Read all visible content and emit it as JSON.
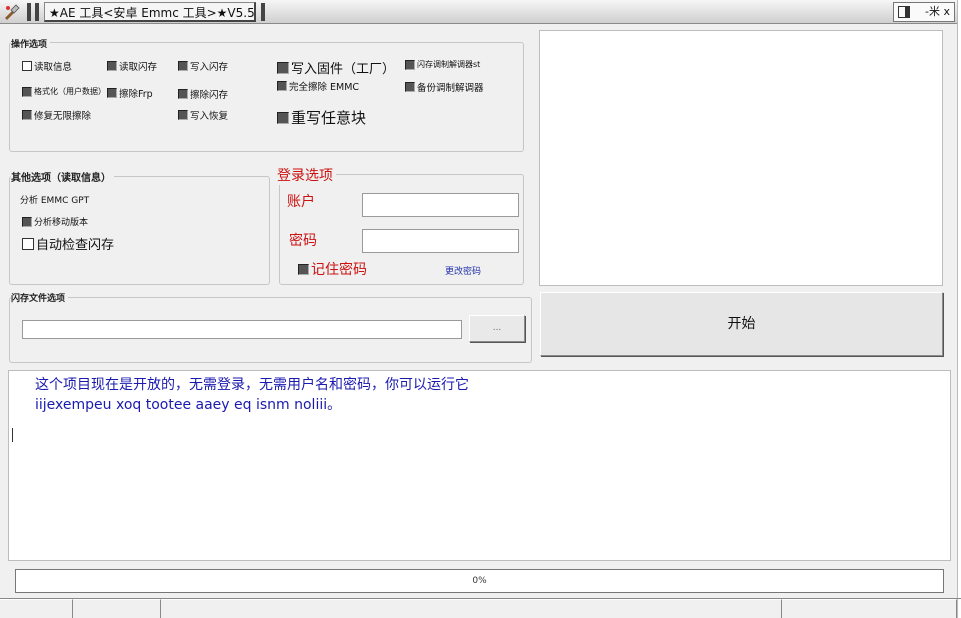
{
  "window": {
    "title": "★AE 工具<安卓 Emmc 工具>★V5.5",
    "controls_label": "-米 x"
  },
  "operations": {
    "title": "操作选项",
    "items": [
      {
        "label": "读取信息",
        "checked": false
      },
      {
        "label": "读取闪存",
        "checked": true
      },
      {
        "label": "写入闪存",
        "checked": true
      },
      {
        "label": "写入固件（工厂）",
        "checked": true
      },
      {
        "label": "闪存调制解调器st",
        "checked": true
      },
      {
        "label": "格式化（用户数据）",
        "checked": true
      },
      {
        "label": "擦除Frp",
        "checked": true
      },
      {
        "label": "擦除闪存",
        "checked": true
      },
      {
        "label": "完全擦除 EMMC",
        "checked": true
      },
      {
        "label": "备份调制解调器",
        "checked": true
      },
      {
        "label": "修复无限擦除",
        "checked": true
      },
      {
        "label": "写入恢复",
        "checked": true
      },
      {
        "label": "重写任意块",
        "checked": true
      }
    ]
  },
  "other": {
    "title": "其他选项（读取信息）",
    "analyze_label": "分析 EMMC GPT",
    "analyze_mobile_label": "分析移动版本",
    "auto_check_label": "自动检查闪存"
  },
  "login": {
    "title": "登录选项",
    "account_label": "账户",
    "account_value": "",
    "password_label": "密码",
    "password_value": "",
    "remember_label": "记住密码",
    "change_password_label": "更改密码"
  },
  "flash_file": {
    "title": "闪存文件选项",
    "path_value": "",
    "browse_label": "..."
  },
  "start_button": "开始",
  "log": {
    "message": "这个项目现在是开放的，无需登录，无需用户名和密码，你可以运行它 iijexempeu xoq tootee aaey eq isnm noliii。"
  },
  "progress": {
    "value": 0,
    "label": "0%"
  },
  "colors": {
    "log_text": "#1a1ab0",
    "login_red": "#cc1111",
    "link_blue": "#2233aa",
    "checkbox_fill": "#555555"
  }
}
